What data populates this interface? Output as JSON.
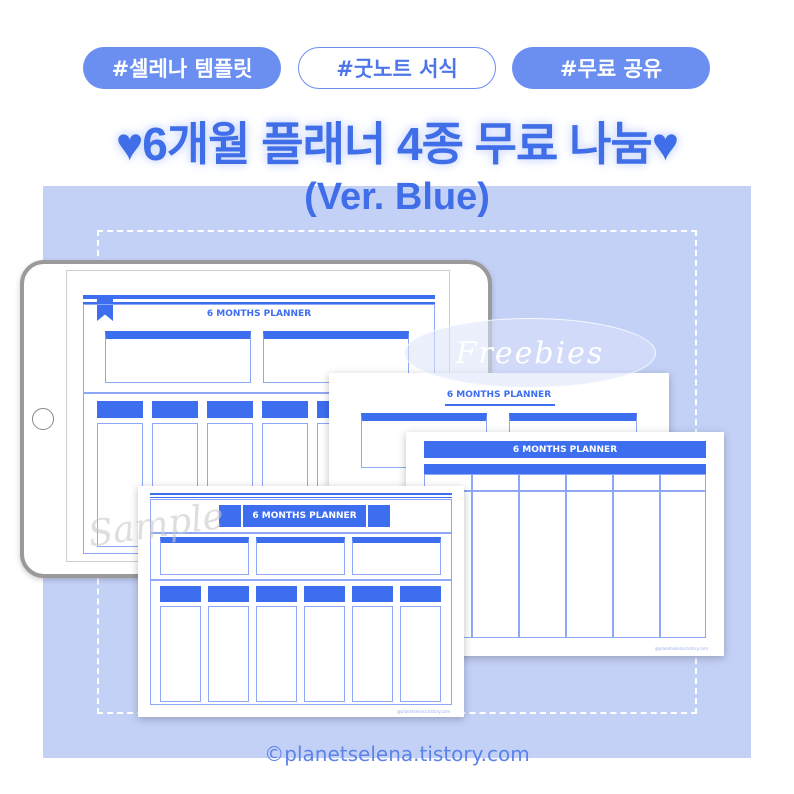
{
  "tags": [
    "#셀레나 템플릿",
    "#굿노트 서식",
    "#무료 공유"
  ],
  "title": "♥6개월 플래너 4종 무료 나눔♥",
  "subtitle": "(Ver. Blue)",
  "planner_title": "6 MONTHS PLANNER",
  "badge": "Freebies",
  "watermark": "Sample",
  "sheet_credit": "@planetselena.tistory.com",
  "footer": "©planetselena.tistory.com",
  "colors": {
    "accent": "#3d6ef0",
    "pill": "#6b8ff0",
    "panel": "#c4d1f7"
  }
}
